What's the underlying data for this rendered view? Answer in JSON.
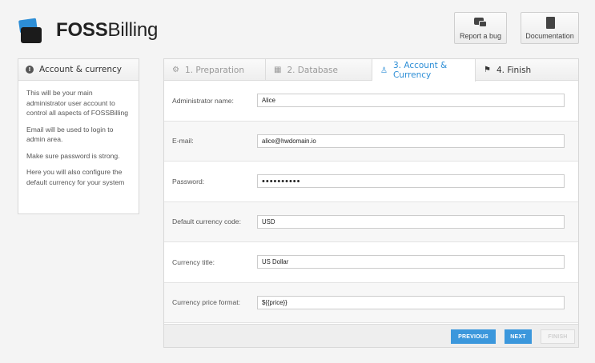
{
  "header": {
    "brand_bold": "FOSS",
    "brand_rest": "Billing",
    "report_bug_label": "Report a bug",
    "documentation_label": "Documentation"
  },
  "sidebar": {
    "title": "Account & currency",
    "paragraphs": [
      "This will be your main administrator user account to control all aspects of FOSSBilling",
      "Email will be used to login to admin area.",
      "Make sure password is strong.",
      "Here you will also configure the default currency for your system"
    ]
  },
  "tabs": [
    {
      "label": "1. Preparation",
      "icon": "cogs-icon"
    },
    {
      "label": "2. Database",
      "icon": "database-icon"
    },
    {
      "label": "3. Account & Currency",
      "icon": "user-icon"
    },
    {
      "label": "4. Finish",
      "icon": "flag-icon"
    }
  ],
  "form": {
    "admin_name": {
      "label": "Administrator name:",
      "value": "Alice"
    },
    "email": {
      "label": "E-mail:",
      "value": "alice@hwdomain.io"
    },
    "password": {
      "label": "Password:",
      "value": "••••••••••"
    },
    "currency_code": {
      "label": "Default currency code:",
      "value": "USD"
    },
    "currency_title": {
      "label": "Currency title:",
      "value": "US Dollar"
    },
    "currency_format": {
      "label": "Currency price format:",
      "value": "${{price}}"
    }
  },
  "buttons": {
    "previous": "PREVIOUS",
    "next": "NEXT",
    "finish": "FINISH"
  },
  "colors": {
    "accent": "#3b97dc",
    "active_tab_text": "#2d8ed6"
  }
}
